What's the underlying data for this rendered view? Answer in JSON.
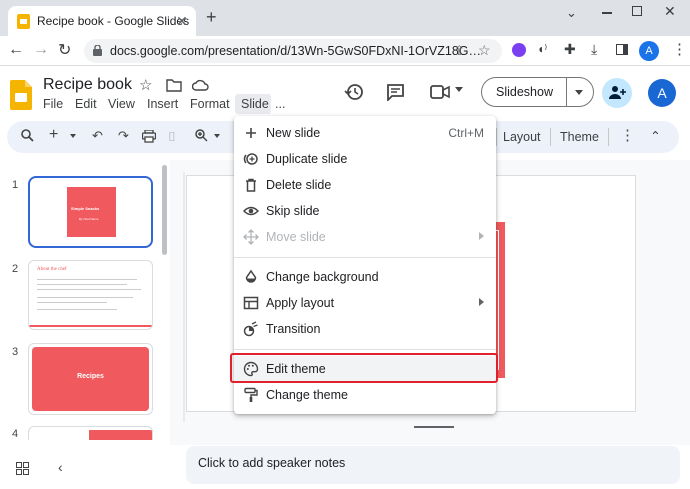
{
  "browser": {
    "tab_title": "Recipe book - Google Slides",
    "url": "docs.google.com/presentation/d/13Wn-5GwS0FDxNI-1OrVZ18G…",
    "profile_initial": "A"
  },
  "doc": {
    "title": "Recipe book",
    "menus": [
      "File",
      "Edit",
      "View",
      "Insert",
      "Format",
      "Slide",
      "..."
    ],
    "slideshow_label": "Slideshow",
    "user_initial": "A"
  },
  "toolbar": {
    "layout_label": "Layout",
    "theme_label": "Theme"
  },
  "filmstrip": {
    "slides": [
      {
        "number": "1",
        "title": "Simple Snacks",
        "subtitle": "By Chef Name"
      },
      {
        "number": "2",
        "title": "About the chef"
      },
      {
        "number": "3",
        "title": "Recipes"
      },
      {
        "number": "4"
      }
    ]
  },
  "slide_menu": {
    "items": [
      {
        "label": "New slide",
        "shortcut": "Ctrl+M",
        "icon": "plus-icon"
      },
      {
        "label": "Duplicate slide",
        "icon": "duplicate-icon"
      },
      {
        "label": "Delete slide",
        "icon": "trash-icon"
      },
      {
        "label": "Skip slide",
        "icon": "eye-icon"
      },
      {
        "label": "Move slide",
        "icon": "move-icon",
        "disabled": true,
        "submenu": true
      },
      {
        "label": "Change background",
        "icon": "paint-drop-icon"
      },
      {
        "label": "Apply layout",
        "icon": "layout-icon",
        "submenu": true
      },
      {
        "label": "Transition",
        "icon": "transition-icon"
      },
      {
        "label": "Edit theme",
        "icon": "palette-icon",
        "highlighted": true
      },
      {
        "label": "Change theme",
        "icon": "paint-roller-icon"
      }
    ]
  },
  "notes": {
    "placeholder": "Click to add speaker notes"
  },
  "colors": {
    "accent_red": "#f05a5e",
    "highlight_red": "#e0202c",
    "selection_blue": "#3367d6",
    "slides_yellow": "#f4b400"
  }
}
